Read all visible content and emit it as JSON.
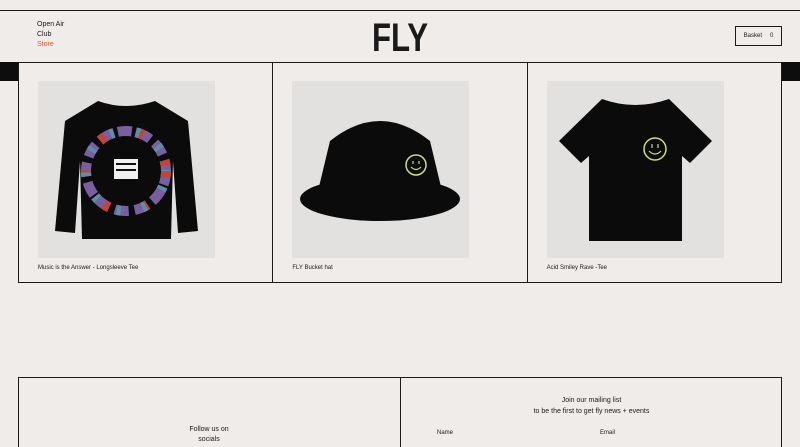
{
  "nav": {
    "items": [
      "Open Air",
      "Club",
      "Store"
    ],
    "active": "Store",
    "active_color": "#e0553a"
  },
  "logo": {
    "text": "FLY"
  },
  "basket": {
    "label": "Basket",
    "count": "0"
  },
  "products": [
    {
      "name": "Music is the Answer - Longsleeve Tee",
      "image": "longsleeve-tee-image"
    },
    {
      "name": "FLY Bucket hat",
      "image": "bucket-hat-image"
    },
    {
      "name": "Acid Smiley Rave -Tee",
      "image": "tee-image"
    }
  ],
  "footer": {
    "follow_line1": "Follow us on",
    "follow_line2": "socials",
    "mailing_line1": "Join our mailing list",
    "mailing_line2": "to be the first to get fly news + events",
    "name_label": "Name",
    "email_label": "Email"
  },
  "colors": {
    "background": "#efecea",
    "ink": "#1a1a1a",
    "accent": "#e0553a",
    "smiley": "#c9e07a"
  }
}
